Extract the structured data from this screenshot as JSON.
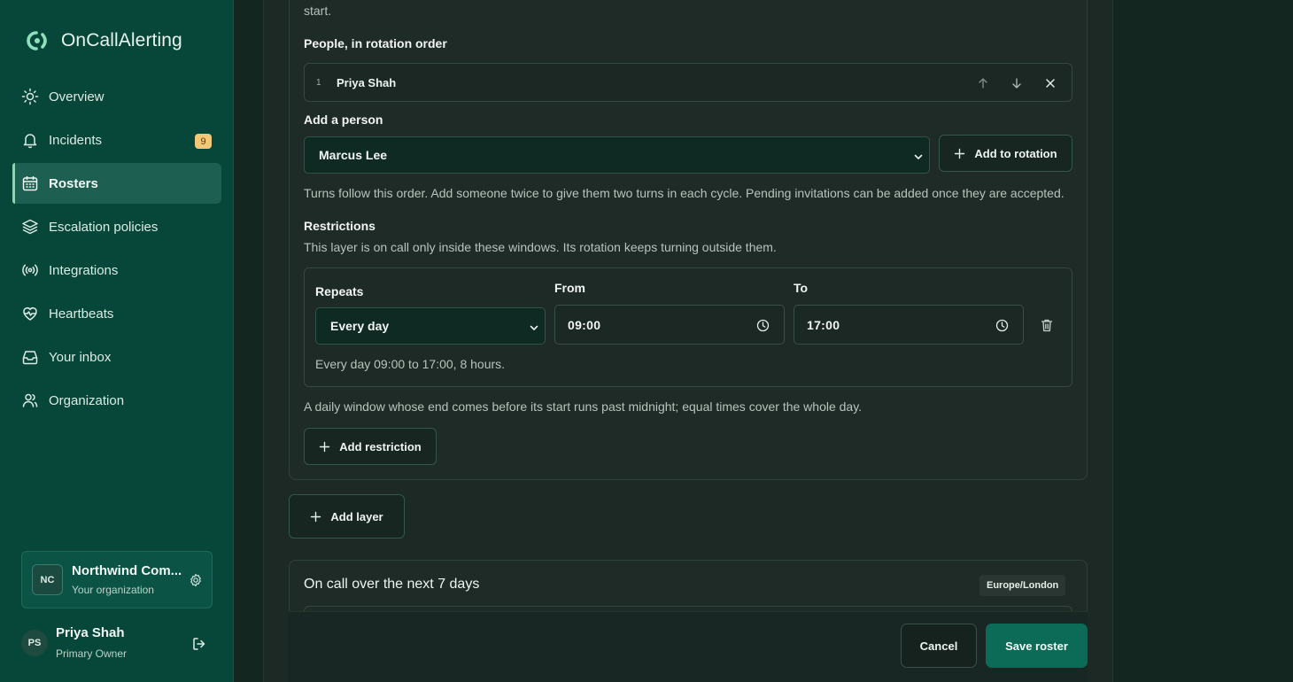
{
  "brand": {
    "name": "OnCallAlerting"
  },
  "sidebar": {
    "items": [
      {
        "label": "Overview",
        "icon": "sun-icon"
      },
      {
        "label": "Incidents",
        "icon": "bell-icon",
        "badge": "9"
      },
      {
        "label": "Rosters",
        "icon": "calendar-icon",
        "active": true
      },
      {
        "label": "Escalation policies",
        "icon": "layers-icon"
      },
      {
        "label": "Integrations",
        "icon": "broadcast-icon"
      },
      {
        "label": "Heartbeats",
        "icon": "heart-pulse-icon"
      },
      {
        "label": "Your inbox",
        "icon": "inbox-icon"
      },
      {
        "label": "Organization",
        "icon": "users-icon"
      }
    ],
    "org": {
      "initials": "NC",
      "name": "Northwind Com...",
      "subtitle": "Your organization"
    },
    "user": {
      "initials": "PS",
      "name": "Priya Shah",
      "role": "Primary Owner"
    }
  },
  "layer": {
    "top_text": "start.",
    "people_label": "People, in rotation order",
    "people": [
      {
        "index": "1",
        "name": "Priya Shah"
      }
    ],
    "add_person_label": "Add a person",
    "add_person_selected": "Marcus Lee",
    "add_to_rotation": "Add to rotation",
    "turns_help": "Turns follow this order. Add someone twice to give them two turns in each cycle. Pending invitations can be added once they are accepted.",
    "restrictions_label": "Restrictions",
    "restrictions_help": "This layer is on call only inside these windows. Its rotation keeps turning outside them.",
    "restriction": {
      "repeats_label": "Repeats",
      "repeats_value": "Every day",
      "from_label": "From",
      "from_value": "09:00",
      "to_label": "To",
      "to_value": "17:00",
      "summary": "Every day 09:00 to 17:00, 8 hours."
    },
    "window_help": "A daily window whose end comes before its start runs past midnight; equal times cover the whole day.",
    "add_restriction": "Add restriction"
  },
  "add_layer": "Add layer",
  "preview": {
    "title": "On call over the next 7 days",
    "timezone": "Europe/London"
  },
  "footer": {
    "cancel": "Cancel",
    "save": "Save roster"
  },
  "colors": {
    "sidebar_bg": "#06473a",
    "accent": "#0c6b57",
    "badge": "#f2c878",
    "panel_bg": "#1c2924"
  }
}
